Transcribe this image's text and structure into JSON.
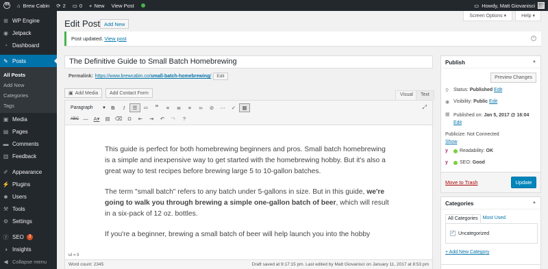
{
  "adminbar": {
    "site_name": "Brew Cabin",
    "updates_count": "2",
    "comments_count": "0",
    "new_label": "New",
    "view_post_label": "View Post",
    "howdy": "Howdy, Matt Giovanisci"
  },
  "sidebar": {
    "items": [
      {
        "label": "WP Engine",
        "icon": "wpengine-icon"
      },
      {
        "label": "Jetpack",
        "icon": "jetpack-icon"
      },
      {
        "label": "Dashboard",
        "icon": "dashboard-icon"
      },
      {
        "label": "Posts",
        "icon": "pin-icon"
      },
      {
        "label": "Media",
        "icon": "media-icon"
      },
      {
        "label": "Pages",
        "icon": "pages-icon"
      },
      {
        "label": "Comments",
        "icon": "comments-icon"
      },
      {
        "label": "Feedback",
        "icon": "feedback-icon"
      },
      {
        "label": "Appearance",
        "icon": "appearance-icon"
      },
      {
        "label": "Plugins",
        "icon": "plugins-icon"
      },
      {
        "label": "Users",
        "icon": "users-icon"
      },
      {
        "label": "Tools",
        "icon": "tools-icon"
      },
      {
        "label": "Settings",
        "icon": "settings-icon"
      },
      {
        "label": "SEO",
        "icon": "seo-icon",
        "badge": "3"
      },
      {
        "label": "Insights",
        "icon": "insights-icon"
      },
      {
        "label": "Collapse menu",
        "icon": "collapse-icon"
      }
    ],
    "posts_submenu": [
      "All Posts",
      "Add New",
      "Categories",
      "Tags"
    ]
  },
  "header": {
    "screen_options": "Screen Options ▾",
    "help": "Help ▾",
    "title": "Edit Post",
    "add_new": "Add New"
  },
  "notice": {
    "text": "Post updated.",
    "link": "View post"
  },
  "post": {
    "title": "The Definitive Guide to Small Batch Homebrewing",
    "permalink_label": "Permalink:",
    "permalink_base": "https://www.brewcabin.co/",
    "permalink_slug": "small-batch-homebrewing",
    "permalink_edit": "Edit"
  },
  "editor": {
    "add_media": "Add Media",
    "add_contact_form": "Add Contact Form",
    "visual_tab": "Visual",
    "text_tab": "Text",
    "format_select": "Paragraph",
    "paragraphs": {
      "p1": "This guide is perfect for both homebrewing beginners and pros. Small batch homebrewing is a simple and inexpensive way to get started with the homebrewing hobby. But it's also a great way to test recipes before brewing large 5 to 10-gallon batches.",
      "p2_start": "The term \"small batch\" refers to any batch under 5-gallons in size. But in this guide, ",
      "p2_bold": "we're going to walk you through brewing a simple one-gallon batch of beer",
      "p2_end": ", which will result in a six-pack of 12 oz. bottles.",
      "p3": "If you're a beginner, brewing a small batch of beer will help launch you into the hobby"
    },
    "path": "ul » li",
    "word_count": "Word count: 2345",
    "draft_status": "Draft saved at 9:17:15 pm. Last edited by Matt Giovanisci on January 11, 2017 at 8:53 pm"
  },
  "publish": {
    "title": "Publish",
    "preview": "Preview Changes",
    "status_label": "Status:",
    "status_value": "Published",
    "visibility_label": "Visibility:",
    "visibility_value": "Public",
    "published_label": "Published on:",
    "published_value": "Jan 5, 2017 @ 16:04",
    "edit": "Edit",
    "publicize": "Publicize: Not Connected",
    "show": "Show",
    "readability_label": "Readability:",
    "readability_value": "OK",
    "seo_label": "SEO:",
    "seo_value": "Good",
    "trash": "Move to Trash",
    "update": "Update"
  },
  "categories": {
    "title": "Categories",
    "tab_all": "All Categories",
    "tab_most_used": "Most Used",
    "items": [
      "Uncategorized"
    ],
    "add_new": "+ Add New Category"
  },
  "colors": {
    "admin_dark": "#23282d",
    "accent_blue": "#0073aa",
    "success_green": "#46b450",
    "seo_badge": "#d54e21"
  }
}
